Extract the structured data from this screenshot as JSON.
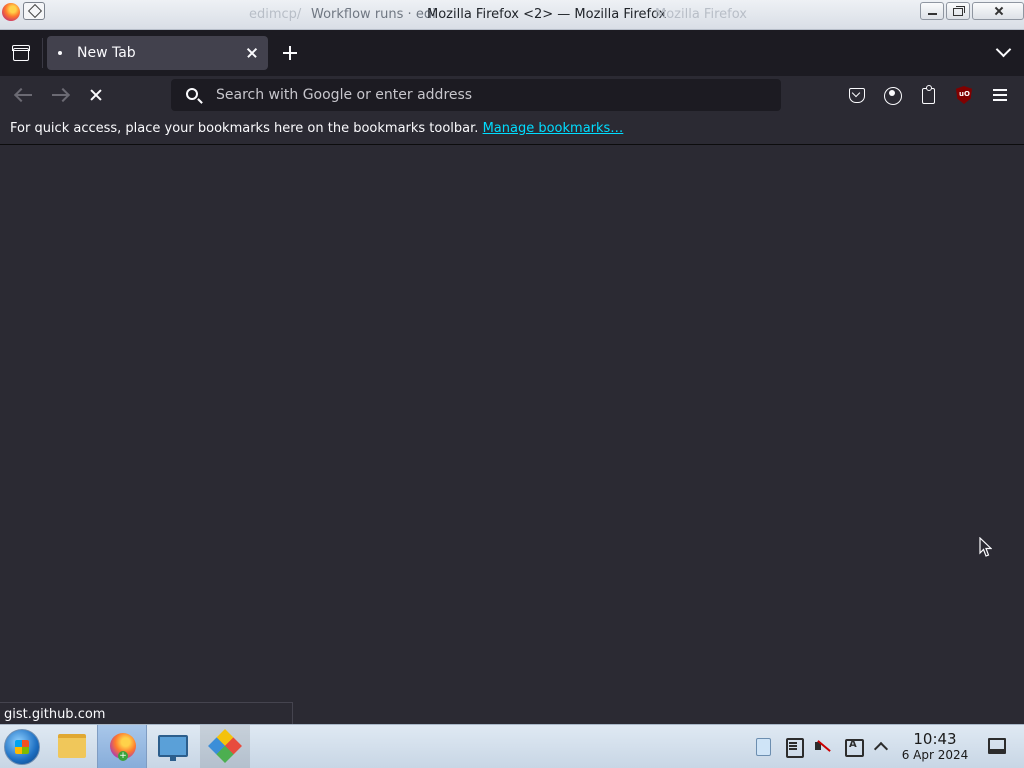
{
  "window": {
    "title": "Mozilla Firefox <2> — Mozilla Firefox",
    "title_main": "Mozilla Firefox <2>",
    "title_sep": " — ",
    "title_app": "Mozilla Firefox",
    "ghost_left": "edimcp/",
    "ghost_workflow": "Workflow runs · edi",
    "ghost_right": "Mozilla Firefox"
  },
  "tabs": [
    {
      "label": "New Tab",
      "active": true
    }
  ],
  "navbar": {
    "url_placeholder": "Search with Google or enter address",
    "url_value": ""
  },
  "bookmarks_bar": {
    "message": "For quick access, place your bookmarks here on the bookmarks toolbar.",
    "link": "Manage bookmarks…"
  },
  "status_bar": {
    "text": "gist.github.com"
  },
  "taskbar": {
    "apps": [
      "file-manager",
      "firefox",
      "system-settings",
      "gem-app"
    ],
    "tray_icons": [
      "clipboard-icon",
      "notes-icon",
      "volume-muted-icon",
      "keyboard-layout-icon",
      "show-hidden-icon"
    ],
    "time": "10:43",
    "date": "6 Apr 2024"
  },
  "colors": {
    "toolbar_bg": "#2b2a33",
    "tabstrip_bg": "#1c1b22",
    "active_tab": "#42414d",
    "link": "#00ddff",
    "text": "#fbfbfe"
  }
}
